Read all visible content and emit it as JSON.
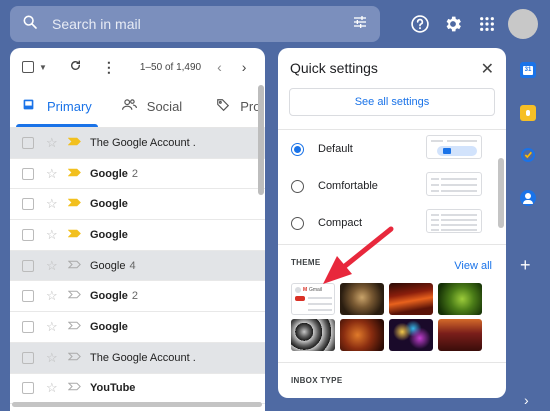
{
  "search": {
    "placeholder": "Search in mail"
  },
  "toolbar": {
    "pagination": "1–50 of 1,490"
  },
  "tabs": [
    {
      "label": "Primary"
    },
    {
      "label": "Social"
    },
    {
      "label": "Pro"
    }
  ],
  "emails": [
    {
      "sender": "The Google Account .",
      "count": "",
      "read": true,
      "important": true
    },
    {
      "sender": "Google",
      "count": "2",
      "read": false,
      "important": true
    },
    {
      "sender": "Google",
      "count": "",
      "read": false,
      "important": true
    },
    {
      "sender": "Google",
      "count": "",
      "read": false,
      "important": true
    },
    {
      "sender": "Google",
      "count": "4",
      "read": true,
      "important": false
    },
    {
      "sender": "Google",
      "count": "2",
      "read": false,
      "important": false
    },
    {
      "sender": "Google",
      "count": "",
      "read": false,
      "important": false
    },
    {
      "sender": "The Google Account .",
      "count": "",
      "read": true,
      "important": false
    },
    {
      "sender": "YouTube",
      "count": "",
      "read": false,
      "important": false
    }
  ],
  "quick_settings": {
    "title": "Quick settings",
    "see_all": "See all settings",
    "density": [
      {
        "label": "Default",
        "checked": true
      },
      {
        "label": "Comfortable",
        "checked": false
      },
      {
        "label": "Compact",
        "checked": false
      }
    ],
    "theme_label": "THEME",
    "view_all": "View all",
    "inbox_type_label": "INBOX TYPE",
    "default_theme_label": "Gmail"
  },
  "colors": {
    "background": "#4f6aa3",
    "accent": "#1a73e8",
    "important": "#f2c01e",
    "arrow": "#e8283c"
  }
}
